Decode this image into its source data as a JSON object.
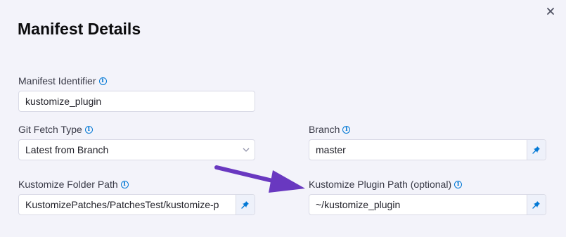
{
  "dialog": {
    "title": "Manifest Details",
    "close_icon": "close-icon"
  },
  "fields": {
    "manifest_identifier": {
      "label": "Manifest Identifier",
      "value": "kustomize_plugin"
    },
    "git_fetch_type": {
      "label": "Git Fetch Type",
      "value": "Latest from Branch"
    },
    "branch": {
      "label": "Branch",
      "value": "master"
    },
    "kustomize_folder_path": {
      "label": "Kustomize Folder Path",
      "value": "KustomizePatches/PatchesTest/kustomize-p"
    },
    "kustomize_plugin_path": {
      "label": "Kustomize Plugin Path (optional)",
      "value": "~/kustomize_plugin"
    }
  },
  "colors": {
    "background": "#f3f3fa",
    "info_icon": "#0278d5",
    "pin_icon": "#0278d5",
    "annotation_arrow": "#6938c0"
  },
  "icons": [
    "info-icon",
    "pin-icon",
    "chevron-down-icon",
    "close-icon",
    "annotation-arrow"
  ]
}
